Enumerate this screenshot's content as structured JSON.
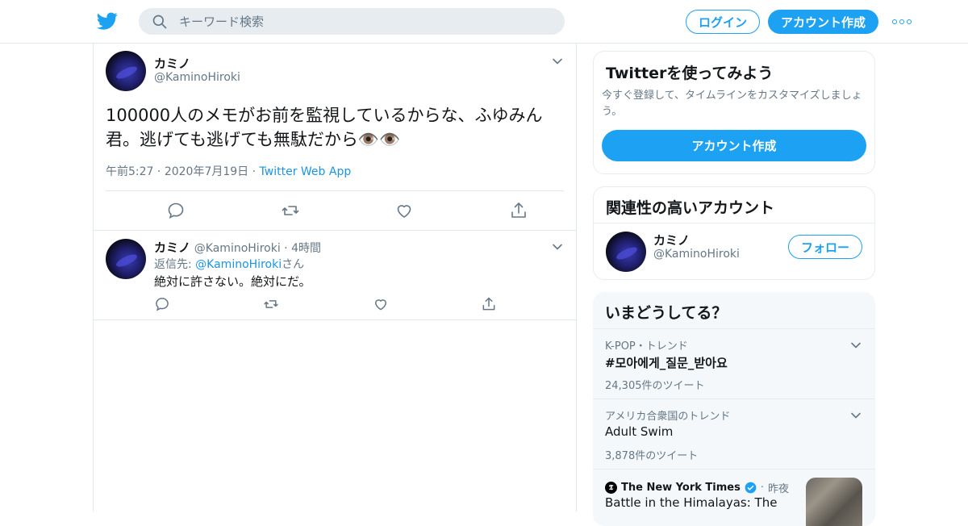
{
  "header": {
    "search_placeholder": "キーワード検索",
    "login_label": "ログイン",
    "signup_label": "アカウント作成"
  },
  "main_tweet": {
    "name": "カミノ",
    "handle": "@KaminoHiroki",
    "text": "100000人のメモがお前を監視しているからな、ふゆみん君。逃げても逃げても無駄だから👁️👁️",
    "time": "午前5:27",
    "date": "2020年7月19日",
    "source": "Twitter Web App"
  },
  "reply": {
    "name": "カミノ",
    "handle": "@KaminoHiroki",
    "age": "4時間",
    "reply_to_prefix": "返信先: ",
    "reply_to_handle": "@KaminoHiroki",
    "reply_to_suffix": "さん",
    "text": "絶対に許さない。絶対にだ。"
  },
  "signup_card": {
    "title": "Twitterを使ってみよう",
    "description": "今すぐ登録して、タイムラインをカスタマイズしましょう。",
    "button": "アカウント作成"
  },
  "related_card": {
    "title": "関連性の高いアカウント",
    "name": "カミノ",
    "handle": "@KaminoHiroki",
    "follow_label": "フォロー"
  },
  "trends_card": {
    "title": "いまどうしてる？",
    "trends": [
      {
        "context": "K-POP・トレンド",
        "title": "#모아에게_질문_받아요",
        "count": "24,305件のツイート"
      },
      {
        "context": "アメリカ合衆国のトレンド",
        "title": "Adult Swim",
        "count": "3,878件のツイート"
      }
    ],
    "news": {
      "source": "The New York Times",
      "when": "昨夜",
      "headline": "Battle in the Himalayas: The"
    }
  },
  "colors": {
    "accent": "#1da1f2",
    "text": "#14171a",
    "secondary": "#657786",
    "border": "#e1e8ed"
  }
}
